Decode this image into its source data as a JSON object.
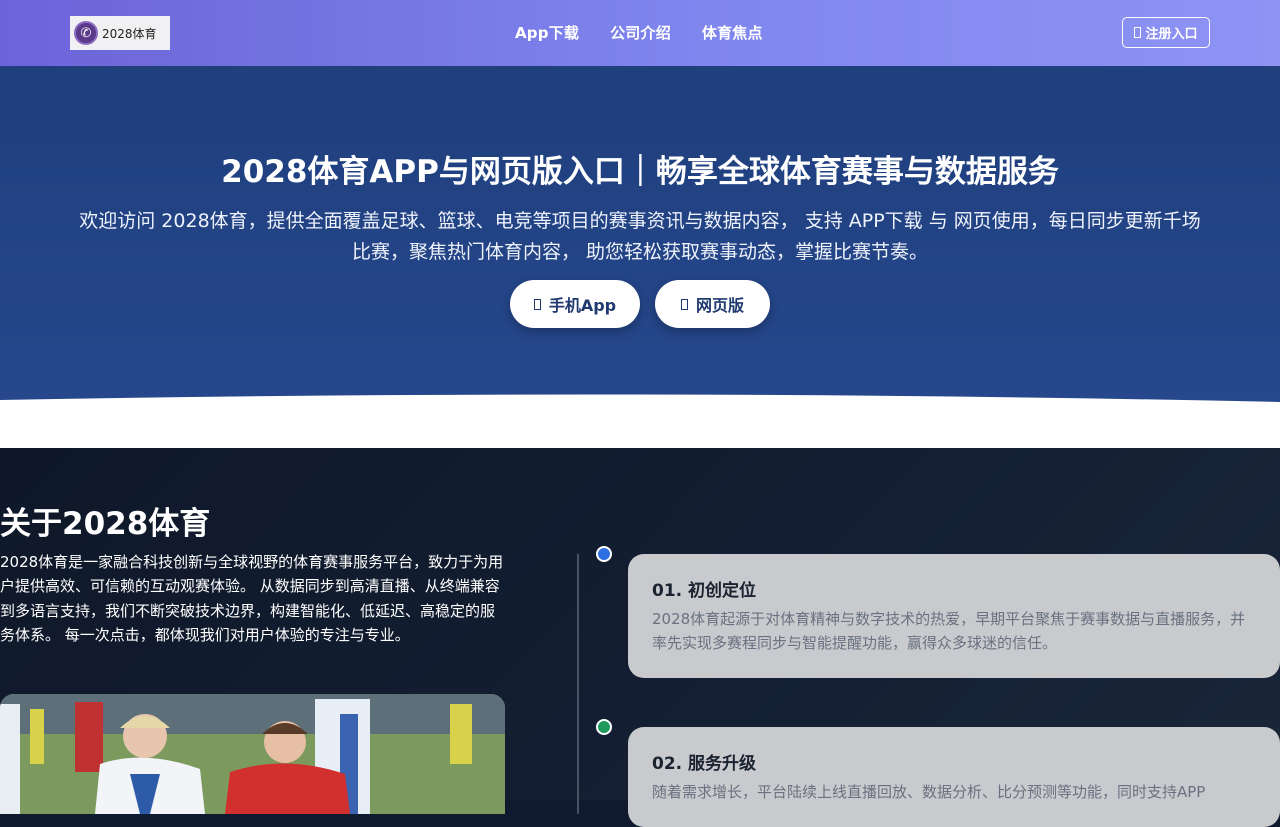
{
  "header": {
    "logo_text": "2028体育",
    "logo_icon": "viber-phone-icon",
    "nav": [
      {
        "label": "App下载"
      },
      {
        "label": "公司介绍"
      },
      {
        "label": "体育焦点"
      }
    ],
    "register_label": "注册入口"
  },
  "hero": {
    "title": "2028体育APP与网页版入口｜畅享全球体育赛事与数据服务",
    "description": "欢迎访问 2028体育，提供全面覆盖足球、篮球、电竞等项目的赛事资讯与数据内容， 支持 APP下载 与 网页使用，每日同步更新千场比赛，聚焦热门体育内容， 助您轻松获取赛事动态，掌握比赛节奏。",
    "btn_app": "手机App",
    "btn_web": "网页版"
  },
  "about": {
    "title": "关于2028体育",
    "text": "2028体育是一家融合科技创新与全球视野的体育赛事服务平台，致力于为用户提供高效、可信赖的互动观赛体验。 从数据同步到高清直播、从终端兼容到多语言支持，我们不断突破技术边界，构建智能化、低延迟、高稳定的服务体系。 每一次点击，都体现我们对用户体验的专注与专业。",
    "timeline": [
      {
        "title": "01. 初创定位",
        "text": "2028体育起源于对体育精神与数字技术的热爱，早期平台聚焦于赛事数据与直播服务，并率先实现多赛程同步与智能提醒功能，赢得众多球迷的信任。"
      },
      {
        "title": "02. 服务升级",
        "text": "随着需求增长，平台陆续上线直播回放、数据分析、比分预测等功能，同时支持APP"
      }
    ]
  },
  "colors": {
    "header_start": "#6c63d8",
    "header_end": "#8e93f4",
    "hero_bg": "#1f3f7d",
    "about_bg": "#0e1829",
    "card_bg": "#c8cacd",
    "dot_blue": "#2f6fe4",
    "dot_green": "#1f9a5a"
  }
}
